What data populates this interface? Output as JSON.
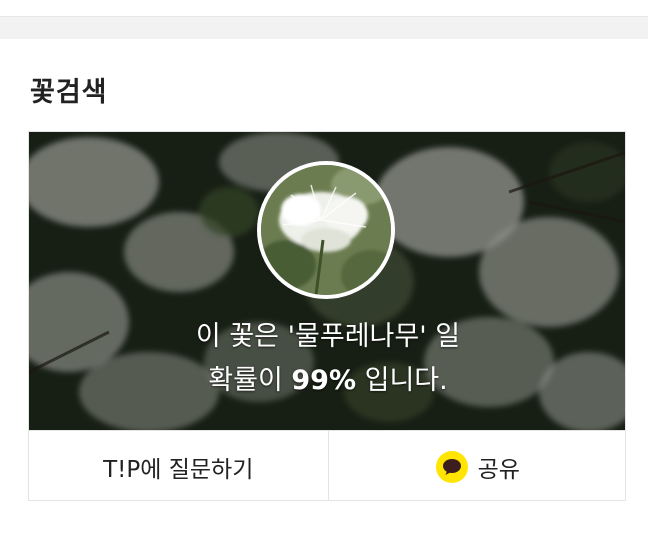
{
  "section": {
    "title": "꽃검색"
  },
  "result": {
    "line1": "이 꽃은 '물푸레나무' 일",
    "line2_prefix": "확률이 ",
    "probability": "99%",
    "line2_suffix": " 입니다."
  },
  "actions": {
    "ask_tip_label": "T!P에 질문하기",
    "share_label": "공유"
  },
  "icons": {
    "share": "kakaotalk-icon"
  },
  "colors": {
    "kakao_yellow": "#ffe500",
    "text_dark": "#222222",
    "divider": "#f2f2f2"
  }
}
